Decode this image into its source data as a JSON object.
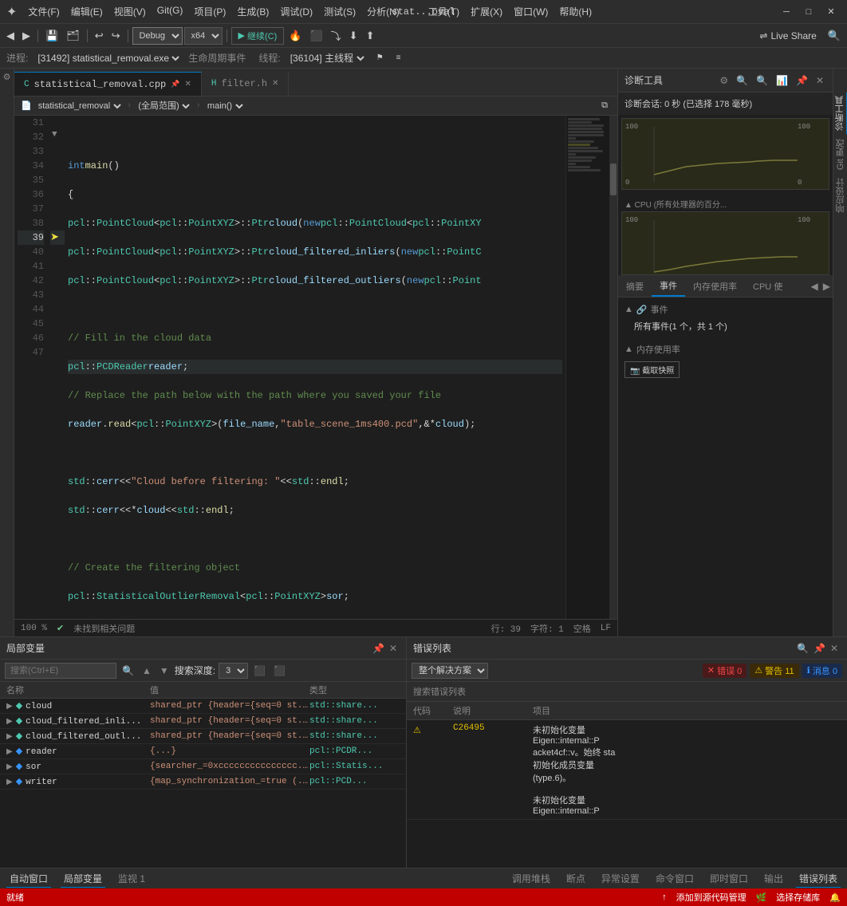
{
  "titleBar": {
    "logo": "✦",
    "menuItems": [
      "文件(F)",
      "编辑(E)",
      "视图(V)",
      "Git(G)",
      "项目(P)",
      "生成(B)",
      "调试(D)",
      "测试(S)",
      "分析(N)"
    ],
    "toolsMenu": [
      "工具(T)",
      "扩展(X)",
      "窗口(W)",
      "帮助(H)"
    ],
    "title": "stat...oval",
    "minimize": "─",
    "maximize": "□",
    "close": "✕"
  },
  "toolbar": {
    "debugConfig": "Debug",
    "platform": "x64",
    "continueBtn": "继续(C)",
    "liveShareBtn": "Live Share",
    "searchIcon": "🔍",
    "settingsIcon": "⚙"
  },
  "debugBar": {
    "processLabel": "进程:",
    "processValue": "[31492] statistical_removal.exe",
    "lifetimeLabel": "生命周期事件",
    "threadLabel": "线程:",
    "threadValue": "[36104] 主线程"
  },
  "editor": {
    "tabs": [
      {
        "label": "statistical_removal.cpp",
        "active": true,
        "modified": false
      },
      {
        "label": "filter.h",
        "active": false,
        "modified": false
      }
    ],
    "breadcrumb": {
      "file": "statistical_removal",
      "scope": "(全局范围)",
      "function": "main()"
    },
    "lines": [
      {
        "num": 31,
        "code": "",
        "type": "empty"
      },
      {
        "num": 32,
        "code": "  int main()",
        "type": "normal",
        "fold": true
      },
      {
        "num": 33,
        "code": "  {",
        "type": "normal"
      },
      {
        "num": 34,
        "code": "    pcl::PointCloud<pcl::PointXYZ>::Ptr cloud(new pcl::PointCloud<pcl::PointXY",
        "type": "normal"
      },
      {
        "num": 35,
        "code": "    pcl::PointCloud<pcl::PointXYZ>::Ptr cloud_filtered_inliers(new pcl::PointC",
        "type": "normal"
      },
      {
        "num": 36,
        "code": "    pcl::PointCloud<pcl::PointXYZ>::Ptr cloud_filtered_outliers(new pcl::Point",
        "type": "normal"
      },
      {
        "num": 37,
        "code": "",
        "type": "empty"
      },
      {
        "num": 38,
        "code": "    // Fill in the cloud data",
        "type": "comment"
      },
      {
        "num": 39,
        "code": "    pcl::PCDReader reader;",
        "type": "current",
        "hasArrow": true
      },
      {
        "num": 40,
        "code": "    // Replace the path below with the path where you saved your file",
        "type": "comment"
      },
      {
        "num": 41,
        "code": "    reader.read<pcl::PointXYZ>(file_name, \"table_scene_1ms400.pcd\", &*cloud);",
        "type": "normal"
      },
      {
        "num": 42,
        "code": "",
        "type": "empty"
      },
      {
        "num": 43,
        "code": "    std::cerr << \"Cloud before filtering: \" << std::endl;",
        "type": "normal"
      },
      {
        "num": 44,
        "code": "    std::cerr << *cloud << std::endl;",
        "type": "normal"
      },
      {
        "num": 45,
        "code": "",
        "type": "empty"
      },
      {
        "num": 46,
        "code": "    // Create the filtering object",
        "type": "comment"
      },
      {
        "num": 47,
        "code": "    pcl::StatisticalOutlierRemoval<pcl::PointXYZ> sor;",
        "type": "normal"
      }
    ],
    "statusBar": {
      "zoom": "100 %",
      "status": "未找到相关问题",
      "line": "行: 39",
      "col": "字符: 1",
      "encoding": "空格",
      "lineEnding": "LF"
    }
  },
  "diagnosticsPanel": {
    "title": "诊断工具",
    "sessionInfo": "诊断会话: 0 秒 (已选择 178 毫秒)",
    "cpuLabel": "▲ CPU (所有处理器的百分...",
    "chartData": {
      "labels": [
        "0",
        "100",
        "0",
        "100"
      ],
      "memory": {
        "min": 0,
        "max": 100
      },
      "cpu": {
        "min": 0,
        "max": 100
      }
    },
    "tabs": [
      "摘要",
      "事件",
      "内存使用率",
      "CPU 使"
    ],
    "activeTab": "事件",
    "eventsSection": {
      "header": "事件",
      "icon": "🔗",
      "content": "所有事件(1 个，共 1 个)"
    },
    "memorySection": {
      "header": "内存使用率",
      "btnLabel": "📷 截取快照"
    }
  },
  "localsPanel": {
    "title": "局部变量",
    "searchPlaceholder": "搜索(Ctrl+E)",
    "depthLabel": "搜索深度:",
    "depthValue": "3",
    "columns": [
      "名称",
      "值",
      "类型"
    ],
    "rows": [
      {
        "name": "cloud",
        "value": "shared_ptr {header={seq=0 st...",
        "type": "std::share..."
      },
      {
        "name": "cloud_filtered_inli...",
        "value": "shared_ptr {header={seq=0 st...",
        "type": "std::share..."
      },
      {
        "name": "cloud_filtered_outl...",
        "value": "shared_ptr {header={seq=0 st...",
        "type": "std::share..."
      },
      {
        "name": "reader",
        "value": "{...}",
        "type": "pcl::PCDR..."
      },
      {
        "name": "sor",
        "value": "{searcher_=0xccccccccccccccc...",
        "type": "pcl::Statis..."
      },
      {
        "name": "writer",
        "value": "{map_synchronization_=true (... ",
        "type": "pcl::PCD..."
      }
    ]
  },
  "errorsPanel": {
    "title": "错误列表",
    "scopeOptions": [
      "整个解决方案"
    ],
    "selectedScope": "整个解决方案",
    "badges": {
      "error": {
        "count": "0",
        "label": "错误 0"
      },
      "warning": {
        "count": "11",
        "label": "警告 11"
      },
      "info": {
        "count": "0",
        "label": "消息 0"
      }
    },
    "subHeader": "搜索错误列表",
    "columns": [
      "代码",
      "说明",
      "项目"
    ],
    "rows": [
      {
        "icon": "⚠",
        "code": "C26495",
        "desc": "未初始化变量\nEigen::internal::P\nacket4cf::v。始终 sta\n初始化成员变量\n(type.6)。\n\n未初始化变量\nEigen::internal::P",
        "project": ""
      }
    ]
  },
  "bottomTabs": [
    "自动窗口",
    "局部变量",
    "监视 1"
  ],
  "bottomTabsRight": [
    "调用堆栈",
    "断点",
    "异常设置",
    "命令窗口",
    "即时窗口",
    "输出",
    "错误列表"
  ],
  "finalStatus": {
    "left": "就绪",
    "centerLeft": "添加到源代码管理",
    "centerRight": "选择存储库",
    "notificationIcon": "🔔"
  },
  "rightSidebar": {
    "items": [
      "诊断工具",
      "Git 更改",
      "响应设计"
    ]
  }
}
